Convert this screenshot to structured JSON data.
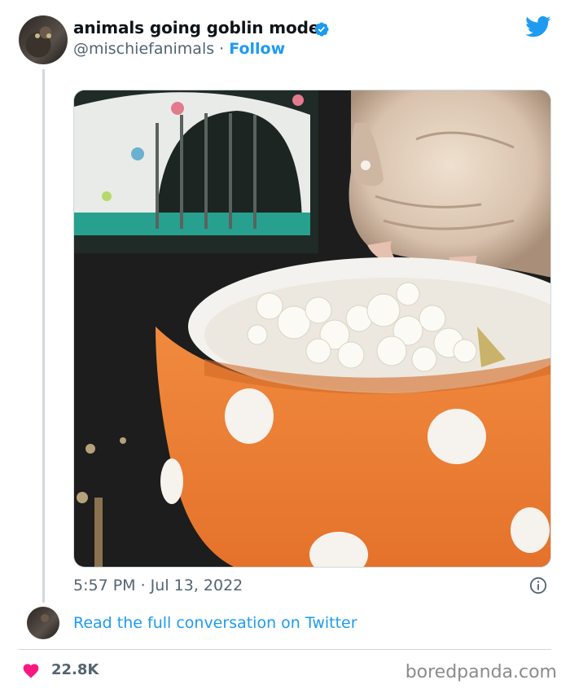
{
  "tweet": {
    "display_name": "animals going goblin mode",
    "handle": "@mischiefanimals",
    "separator": " · ",
    "follow_label": "Follow",
    "timestamp": "5:57 PM · Jul 13, 2022",
    "read_more_label": "Read the full conversation on Twitter",
    "likes": "22.8K"
  },
  "icons": {
    "brand": "twitter-bird-icon",
    "verified": "verified-badge-icon",
    "info": "info-icon",
    "like": "heart-icon"
  },
  "colors": {
    "accent": "#1d9bf0",
    "heart": "#f91880",
    "muted": "#536471"
  },
  "watermark": "boredpanda.com"
}
